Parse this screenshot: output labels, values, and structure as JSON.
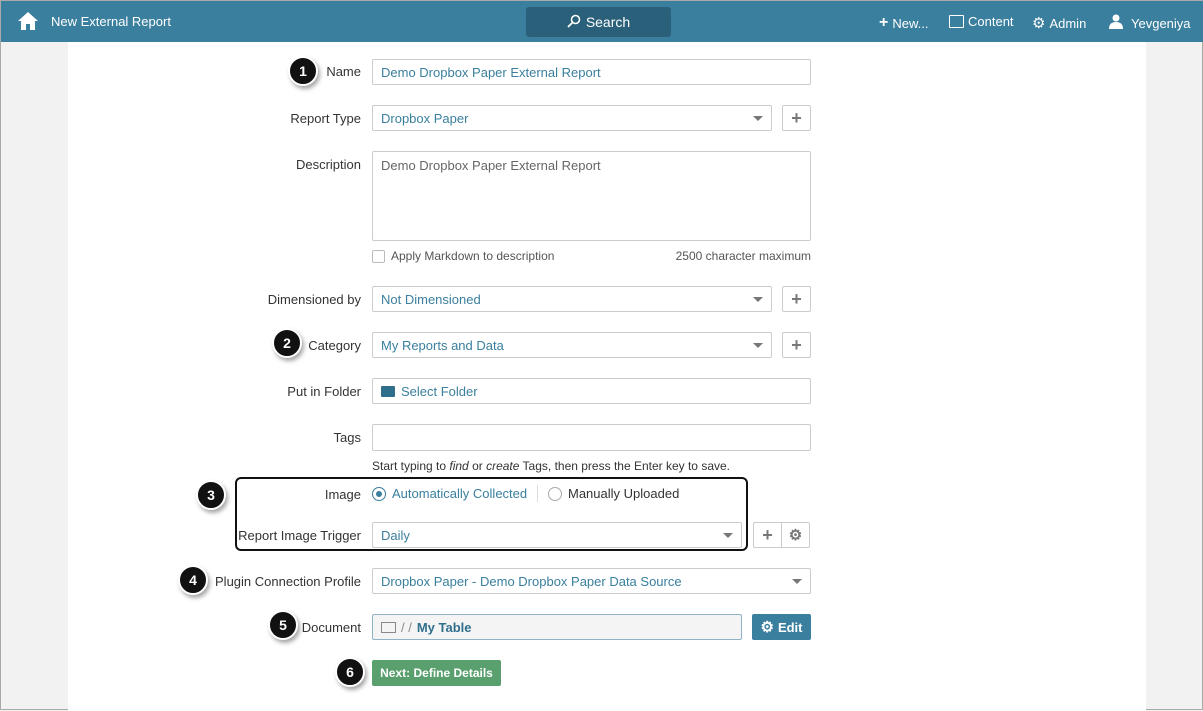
{
  "topbar": {
    "title": "New External Report",
    "search": "Search",
    "new": "New...",
    "content": "Content",
    "admin": "Admin",
    "user": "Yevgeniya"
  },
  "form": {
    "name_label": "Name",
    "name_value": "Demo Dropbox Paper External Report",
    "report_type_label": "Report Type",
    "report_type_value": "Dropbox Paper",
    "description_label": "Description",
    "description_value": "Demo Dropbox Paper External Report",
    "markdown_label": "Apply Markdown to description",
    "char_max": "2500 character maximum",
    "dimensioned_label": "Dimensioned by",
    "dimensioned_value": "Not Dimensioned",
    "category_label": "Category",
    "category_value": "My Reports and Data",
    "folder_label": "Put in Folder",
    "folder_value": "Select Folder",
    "tags_label": "Tags",
    "tags_hint_1": "Start typing to ",
    "tags_hint_find": "find",
    "tags_hint_2": " or ",
    "tags_hint_create": "create",
    "tags_hint_3": " Tags, then press the Enter key to save.",
    "image_label": "Image",
    "image_auto": "Automatically Collected",
    "image_manual": "Manually Uploaded",
    "trigger_label": "Report Image Trigger",
    "trigger_value": "Daily",
    "plugin_label": "Plugin Connection Profile",
    "plugin_value": "Dropbox Paper - Demo Dropbox Paper Data Source",
    "document_label": "Document",
    "document_sep": "/ /",
    "document_value": "My Table",
    "edit": "Edit",
    "next": "Next: Define Details"
  },
  "badges": [
    "1",
    "2",
    "3",
    "4",
    "5",
    "6"
  ]
}
